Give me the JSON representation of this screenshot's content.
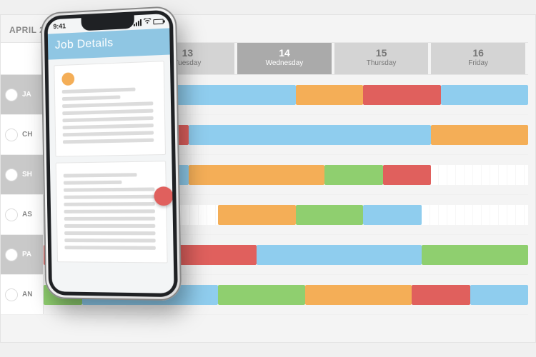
{
  "schedule": {
    "month_label": "APRIL 2...",
    "days": [
      {
        "num": "",
        "dow": "",
        "cls": "active",
        "name": "day-col-hidden"
      },
      {
        "num": "13",
        "dow": "Tuesday",
        "cls": "",
        "name": "day-col-13"
      },
      {
        "num": "14",
        "dow": "Wednesday",
        "cls": "dark",
        "name": "day-col-14"
      },
      {
        "num": "15",
        "dow": "Thursday",
        "cls": "",
        "name": "day-col-15"
      },
      {
        "num": "16",
        "dow": "Friday",
        "cls": "",
        "name": "day-col-16"
      }
    ],
    "rows": [
      {
        "label": "JA",
        "shaded": true,
        "segments": [
          {
            "start": 0,
            "end": 16,
            "color": "green"
          },
          {
            "start": 16,
            "end": 52,
            "color": "blue"
          },
          {
            "start": 52,
            "end": 66,
            "color": "orange"
          },
          {
            "start": 66,
            "end": 82,
            "color": "red"
          },
          {
            "start": 82,
            "end": 100,
            "color": "blue"
          }
        ]
      },
      {
        "label": "CH",
        "shaded": false,
        "segments": [
          {
            "start": 0,
            "end": 30,
            "color": "red"
          },
          {
            "start": 30,
            "end": 80,
            "color": "blue"
          },
          {
            "start": 80,
            "end": 100,
            "color": "orange"
          }
        ]
      },
      {
        "label": "SH",
        "shaded": true,
        "segments": [
          {
            "start": 8,
            "end": 30,
            "color": "blue"
          },
          {
            "start": 30,
            "end": 58,
            "color": "orange"
          },
          {
            "start": 58,
            "end": 70,
            "color": "green"
          },
          {
            "start": 70,
            "end": 80,
            "color": "red"
          }
        ]
      },
      {
        "label": "AS",
        "shaded": false,
        "segments": [
          {
            "start": 36,
            "end": 52,
            "color": "orange"
          },
          {
            "start": 52,
            "end": 66,
            "color": "green"
          },
          {
            "start": 66,
            "end": 78,
            "color": "blue"
          }
        ]
      },
      {
        "label": "PA",
        "shaded": true,
        "segments": [
          {
            "start": 0,
            "end": 44,
            "color": "red"
          },
          {
            "start": 44,
            "end": 78,
            "color": "blue"
          },
          {
            "start": 78,
            "end": 100,
            "color": "green"
          }
        ]
      },
      {
        "label": "AN",
        "shaded": false,
        "segments": [
          {
            "start": 0,
            "end": 8,
            "color": "green"
          },
          {
            "start": 8,
            "end": 36,
            "color": "blue"
          },
          {
            "start": 36,
            "end": 54,
            "color": "green"
          },
          {
            "start": 54,
            "end": 76,
            "color": "orange"
          },
          {
            "start": 76,
            "end": 88,
            "color": "red"
          },
          {
            "start": 88,
            "end": 100,
            "color": "blue"
          }
        ]
      }
    ]
  },
  "phone": {
    "status_time": "9:41",
    "app_title": "Job Details"
  }
}
